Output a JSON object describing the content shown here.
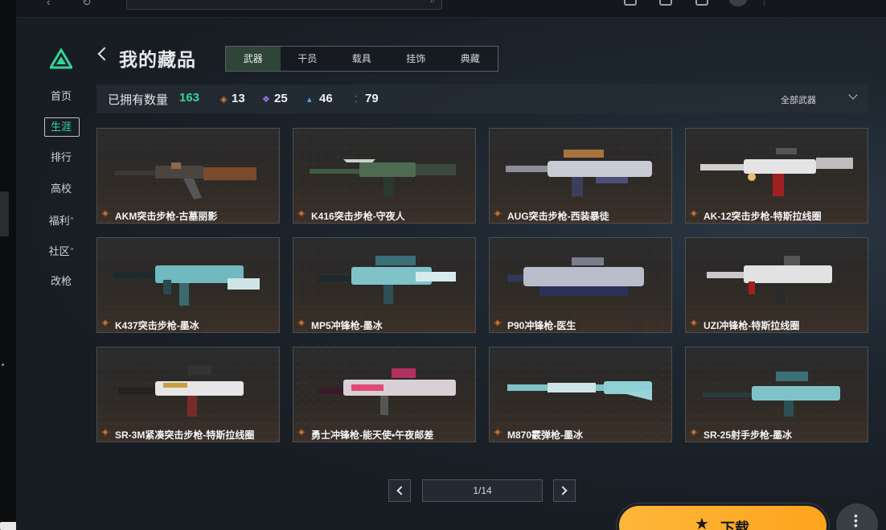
{
  "colors": {
    "accent_green": "#35d39a",
    "rarity_orange": "#e07a35",
    "rarity_purple": "#a37af0",
    "rarity_blue": "#5ba8f5",
    "rarity_green": "#35d39a",
    "download": "#ffae2e"
  },
  "topbar": {
    "icons": [
      "back-icon",
      "refresh-icon",
      "search-icon",
      "chat-icon",
      "shirt-icon",
      "gamepad-icon",
      "avatar",
      "minimize-icon"
    ]
  },
  "sidebar": {
    "items": [
      {
        "label": "首页"
      },
      {
        "label": "生涯",
        "active": true
      },
      {
        "label": "排行"
      },
      {
        "label": "高校"
      },
      {
        "label": "福利",
        "caret": "^"
      },
      {
        "label": "社区",
        "caret": "^"
      },
      {
        "label": "改枪"
      }
    ]
  },
  "header": {
    "title": "我的藏品"
  },
  "tabs": [
    {
      "label": "武器",
      "active": true
    },
    {
      "label": "干员"
    },
    {
      "label": "载具"
    },
    {
      "label": "挂饰"
    },
    {
      "label": "典藏"
    }
  ],
  "counts": {
    "label": "已拥有数量",
    "total": "163",
    "rarities": [
      {
        "icon": "orange-gem-icon",
        "value": "13"
      },
      {
        "icon": "purple-gem-icon",
        "value": "25"
      },
      {
        "icon": "blue-gem-icon",
        "value": "46"
      },
      {
        "icon": "green-gem-icon",
        "value": "79"
      }
    ],
    "filter": "全部武器"
  },
  "items": [
    {
      "name": "AKM突击步枪-古墓丽影"
    },
    {
      "name": "K416突击步枪-守夜人"
    },
    {
      "name": "AUG突击步枪-西装暴徒"
    },
    {
      "name": "AK-12突击步枪-特斯拉线圈"
    },
    {
      "name": "K437突击步枪-墨冰"
    },
    {
      "name": "MP5冲锋枪-墨冰"
    },
    {
      "name": "P90冲锋枪-医生"
    },
    {
      "name": "UZI冲锋枪-特斯拉线圈"
    },
    {
      "name": "SR-3M紧凑突击步枪-特斯拉线圈"
    },
    {
      "name": "勇士冲锋枪-能天使•午夜邮差"
    },
    {
      "name": "M870霰弹枪-墨冰"
    },
    {
      "name": "SR-25射手步枪-墨冰"
    }
  ],
  "pagination": {
    "label": "1/14"
  },
  "download": {
    "label": "下载"
  }
}
